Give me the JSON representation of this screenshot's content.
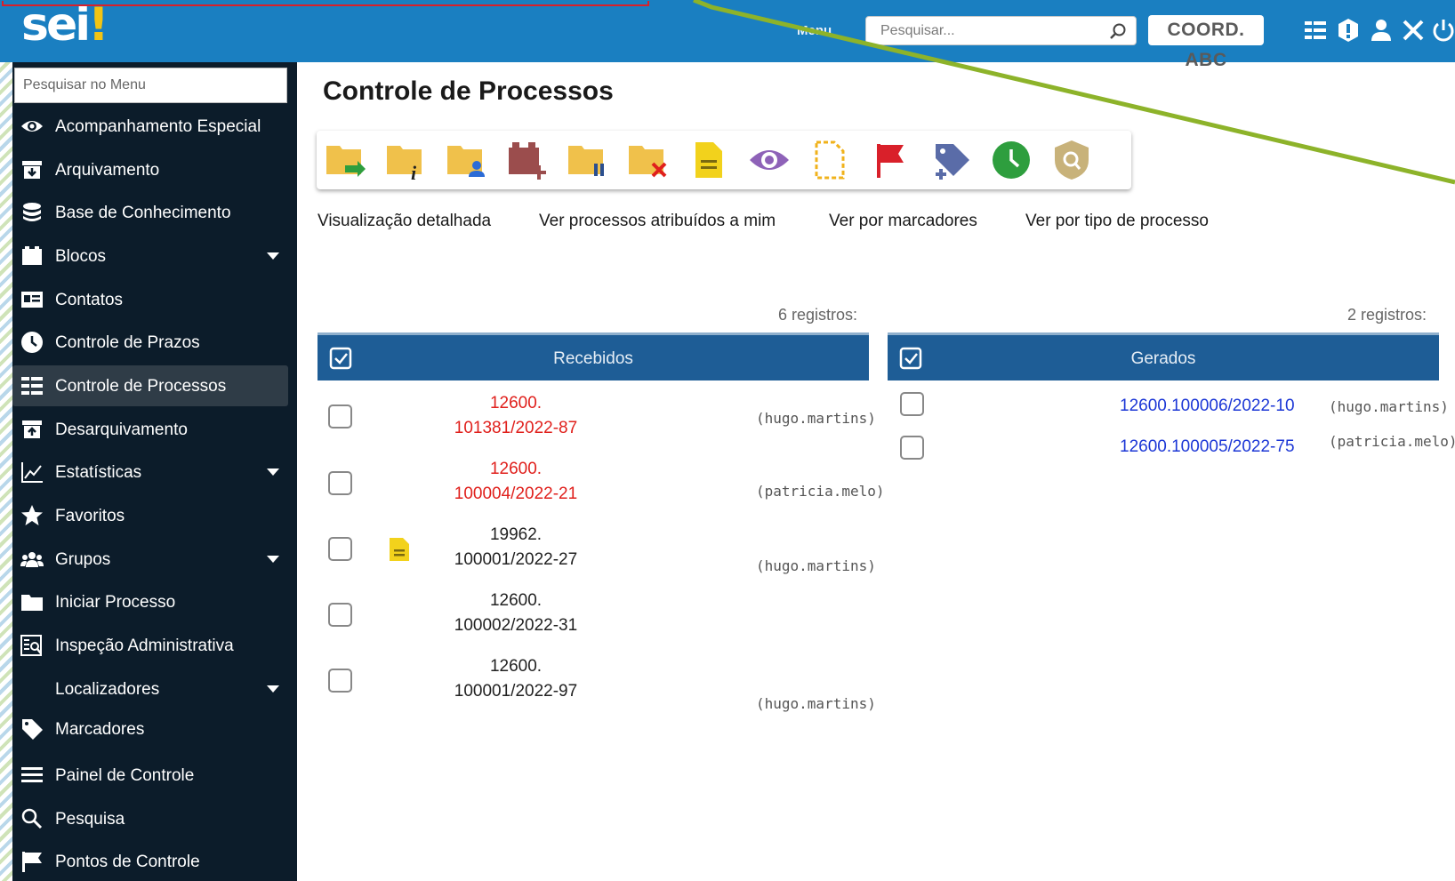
{
  "header": {
    "logo_text": "sei",
    "logo_bang": "!",
    "menu_label": "Menu",
    "search_placeholder": "Pesquisar...",
    "unit_badge": "COORD. ABC",
    "icons": [
      "search-icon",
      "list-icon",
      "alert-icon",
      "user-icon",
      "tools-icon",
      "power-icon"
    ],
    "brand_color": "#1a7fc1",
    "accent_color": "#f2c414"
  },
  "sidebar": {
    "search_placeholder": "Pesquisar no Menu",
    "items": [
      {
        "label": "Acompanhamento Especial",
        "icon": "eye-icon",
        "submenu": false
      },
      {
        "label": "Arquivamento",
        "icon": "archive-box-icon",
        "submenu": false
      },
      {
        "label": "Base de Conhecimento",
        "icon": "database-icon",
        "submenu": false
      },
      {
        "label": "Blocos",
        "icon": "blocks-icon",
        "submenu": true
      },
      {
        "label": "Contatos",
        "icon": "contact-card-icon",
        "submenu": false
      },
      {
        "label": "Controle de Prazos",
        "icon": "clock-icon",
        "submenu": false
      },
      {
        "label": "Controle de Processos",
        "icon": "process-list-icon",
        "submenu": false,
        "active": true
      },
      {
        "label": "Desarquivamento",
        "icon": "unarchive-box-icon",
        "submenu": false
      },
      {
        "label": "Estatísticas",
        "icon": "chart-line-icon",
        "submenu": true
      },
      {
        "label": "Favoritos",
        "icon": "star-icon",
        "submenu": false
      },
      {
        "label": "Grupos",
        "icon": "group-icon",
        "submenu": true
      },
      {
        "label": "Iniciar Processo",
        "icon": "folder-icon",
        "submenu": false
      },
      {
        "label": "Inspeção Administrativa",
        "icon": "inspection-icon",
        "submenu": false
      },
      {
        "label": "Localizadores",
        "icon": "",
        "submenu": true
      },
      {
        "label": "Marcadores",
        "icon": "tag-icon",
        "submenu": false
      },
      {
        "label": "Painel de Controle",
        "icon": "menu-bars-icon",
        "submenu": false
      },
      {
        "label": "Pesquisa",
        "icon": "search-icon",
        "submenu": false
      },
      {
        "label": "Pontos de Controle",
        "icon": "flag-icon",
        "submenu": false
      }
    ]
  },
  "main": {
    "title": "Controle de Processos",
    "toolbar_icons": [
      "folder-forward-icon",
      "folder-info-icon",
      "folder-user-icon",
      "block-add-icon",
      "folder-pause-icon",
      "folder-close-icon",
      "note-icon",
      "eye-icon",
      "document-dashed-icon",
      "red-flag-icon",
      "tag-add-icon",
      "green-clock-icon",
      "shield-search-icon"
    ],
    "view_links": [
      "Visualização detalhada",
      "Ver processos atribuídos a mim",
      "Ver por marcadores",
      "Ver por tipo de processo"
    ],
    "received": {
      "count_text": "6 registros:",
      "header": "Recebidos",
      "rows": [
        {
          "line1": "12600.",
          "line2": "101381/2022-87",
          "user": "(hugo.martins)",
          "color": "red"
        },
        {
          "line1": "12600.",
          "line2": "100004/2022-21",
          "user": "(patricia.melo)",
          "color": "red"
        },
        {
          "line1": "19962.",
          "line2": "100001/2022-27",
          "user": "(hugo.martins)",
          "color": "black",
          "note": true
        },
        {
          "line1": "12600.",
          "line2": "100002/2022-31",
          "user": "",
          "color": "black"
        },
        {
          "line1": "12600.",
          "line2": "100001/2022-97",
          "user": "(hugo.martins)",
          "color": "black"
        }
      ]
    },
    "generated": {
      "count_text": "2 registros:",
      "header": "Gerados",
      "rows": [
        {
          "number": "12600.100006/2022-10",
          "user": "(hugo.martins)"
        },
        {
          "number": "12600.100005/2022-75",
          "user": "(patricia.melo)"
        }
      ]
    },
    "table_header_color": "#1e5d96",
    "received_red": "#e0201c",
    "generated_link_color": "#1c37d6"
  }
}
